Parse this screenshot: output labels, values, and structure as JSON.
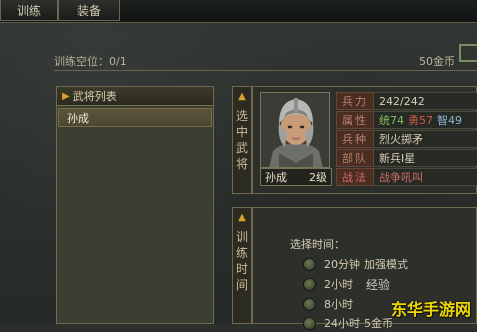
{
  "tabs": [
    "训练",
    "装备"
  ],
  "info": {
    "train_slots": "训练空位：0/1",
    "gold": "50金币"
  },
  "general_list": {
    "header": "武将列表",
    "items": [
      "孙成"
    ]
  },
  "side_labels": {
    "selected_general": [
      "选",
      "中",
      "武",
      "将"
    ],
    "training_time": [
      "训",
      "练",
      "时",
      "间"
    ]
  },
  "general": {
    "name": "孙成",
    "level": "2级",
    "stats": [
      {
        "label": "兵力",
        "value": "242/242"
      },
      {
        "label": "属性"
      },
      {
        "label": "兵种",
        "value": "烈火掷矛"
      },
      {
        "label": "部队",
        "value": "新兵Ⅰ星"
      },
      {
        "label": "战法",
        "value": "战争吼叫"
      }
    ],
    "attributes": {
      "a": "统74",
      "b": "勇57",
      "c": "智49"
    }
  },
  "training": {
    "title": "选择时间：",
    "options": [
      {
        "time": "20分钟",
        "mode": "加强模式"
      },
      {
        "time": "2小时",
        "mode": ""
      },
      {
        "time": "8小时",
        "mode": ""
      },
      {
        "time": "24小时",
        "mode": "5金币"
      }
    ]
  },
  "watermark": "东华手游网",
  "watermark_icon": "经验"
}
